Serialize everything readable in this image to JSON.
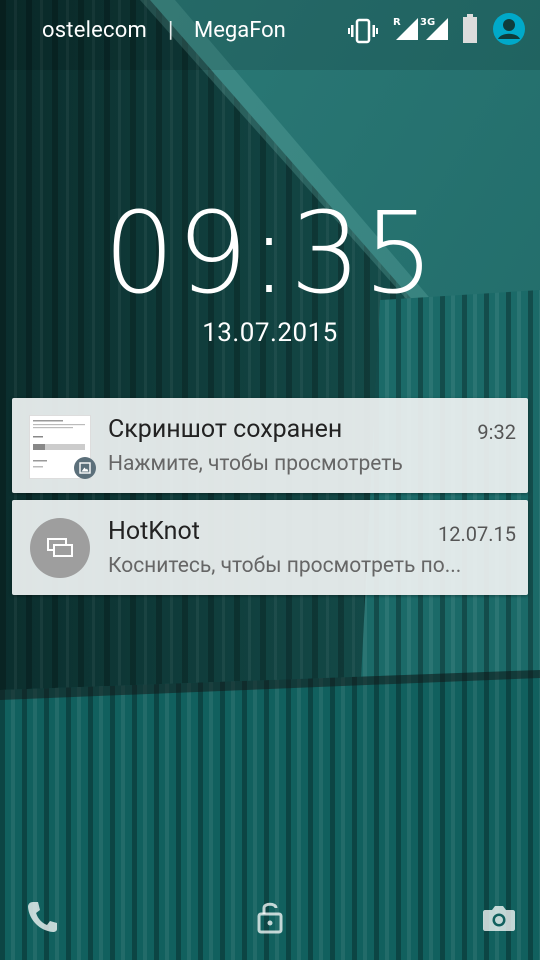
{
  "status_bar": {
    "carrier_1": "ostelecom",
    "separator": "|",
    "carrier_2": "MegaFon",
    "roaming_label": "R",
    "network_label": "3G",
    "icons": [
      "vibrate-icon",
      "signal-roaming-icon",
      "signal-3g-icon",
      "battery-icon",
      "user-avatar-icon"
    ],
    "accent": "#00a9c9"
  },
  "clock": {
    "time": "09:35",
    "date": "13.07.2015"
  },
  "notifications": [
    {
      "icon": "screenshot-thumbnail",
      "badge_icon": "image-icon",
      "title": "Скриншот сохранен",
      "time": "9:32",
      "text": "Нажмите, чтобы просмотреть"
    },
    {
      "icon": "hotknot-icon",
      "title": "HotKnot",
      "time": "12.07.15",
      "text": "Коснитесь, чтобы просмотреть по..."
    }
  ],
  "bottom_shortcuts": [
    "phone-icon",
    "unlock-icon",
    "camera-icon"
  ],
  "colors": {
    "wallpaper_dark": "#0f3d3b",
    "wallpaper_mid": "#1a6564",
    "card_bg": "#eef1f1"
  }
}
